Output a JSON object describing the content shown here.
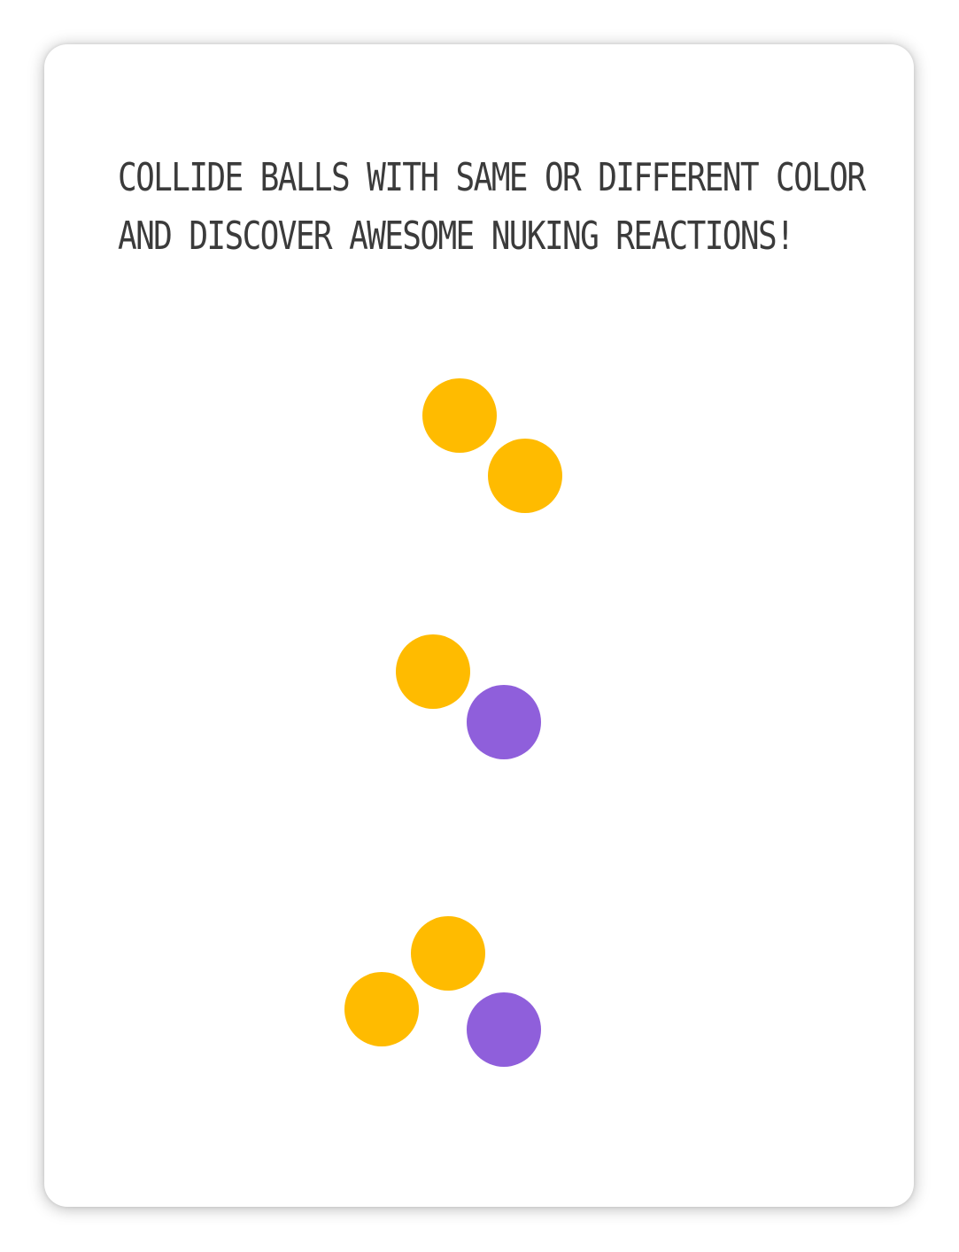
{
  "instructions": {
    "line1": "COLLIDE BALLS WITH SAME OR DIFFERENT COLOR",
    "line2": "AND DISCOVER AWESOME NUKING REACTIONS!"
  },
  "colors": {
    "yellow": "#FFBB00",
    "purple": "#8F5FDB"
  },
  "examples": [
    {
      "name": "same-color-collision",
      "balls": [
        "yellow",
        "yellow"
      ]
    },
    {
      "name": "different-color-collision",
      "balls": [
        "yellow",
        "purple"
      ]
    },
    {
      "name": "three-ball-collision",
      "balls": [
        "yellow",
        "yellow",
        "purple"
      ]
    }
  ]
}
